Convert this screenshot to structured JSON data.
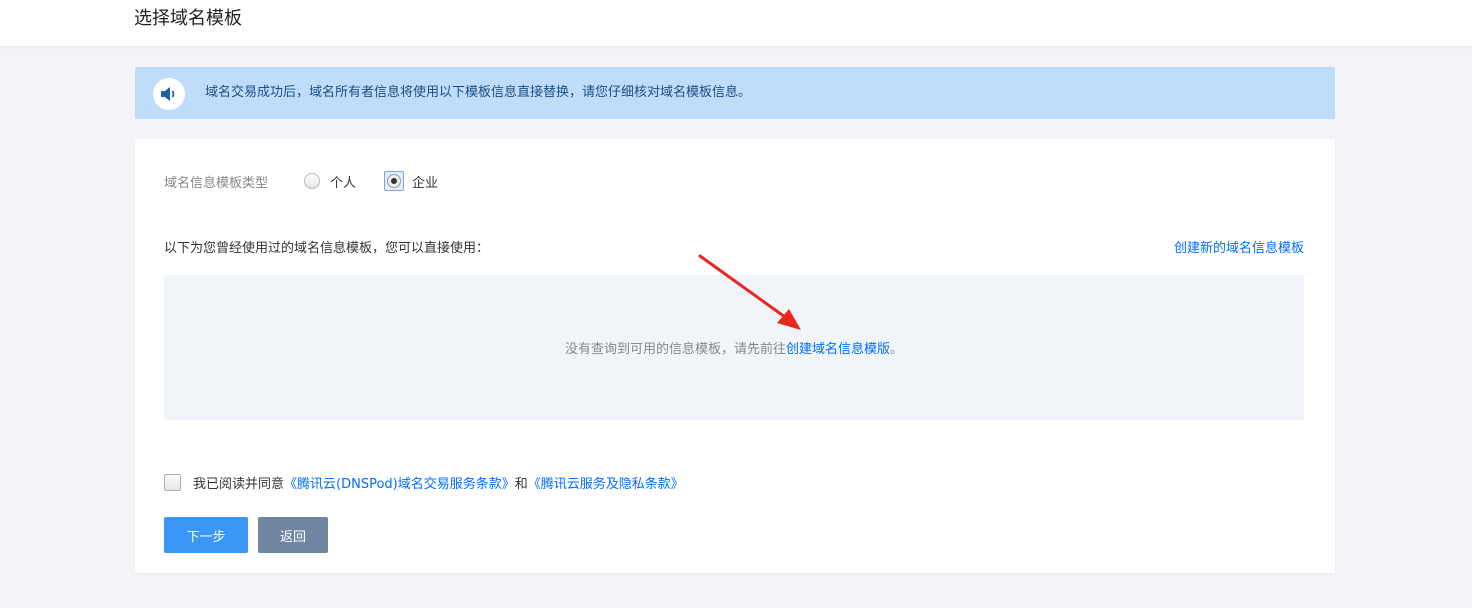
{
  "header": {
    "title": "选择域名模板"
  },
  "notice": {
    "icon": "speaker-icon",
    "text": "域名交易成功后，域名所有者信息将使用以下模板信息直接替换，请您仔细核对域名模板信息。",
    "bg_color": "#bfdcfb"
  },
  "template_type": {
    "label": "域名信息模板类型",
    "options": [
      {
        "label": "个人",
        "selected": false
      },
      {
        "label": "企业",
        "selected": true
      }
    ]
  },
  "history": {
    "hint": "以下为您曾经使用过的域名信息模板，您可以直接使用：",
    "create_new_link": "创建新的域名信息模板",
    "empty_text": "没有查询到可用的信息模板，请先前往",
    "empty_link": "创建域名信息模版",
    "empty_suffix": "。"
  },
  "agreement": {
    "checked": false,
    "prefix": "我已阅读并同意",
    "link1": "《腾讯云(DNSPod)域名交易服务条款》",
    "conjunction": "和",
    "link2": "《腾讯云服务及隐私条款》"
  },
  "buttons": {
    "next": "下一步",
    "back": "返回"
  },
  "colors": {
    "link": "#006eff",
    "primary_button": "#3b97f5",
    "secondary_button": "#6f86a3",
    "annotation_arrow": "#e8271f"
  }
}
